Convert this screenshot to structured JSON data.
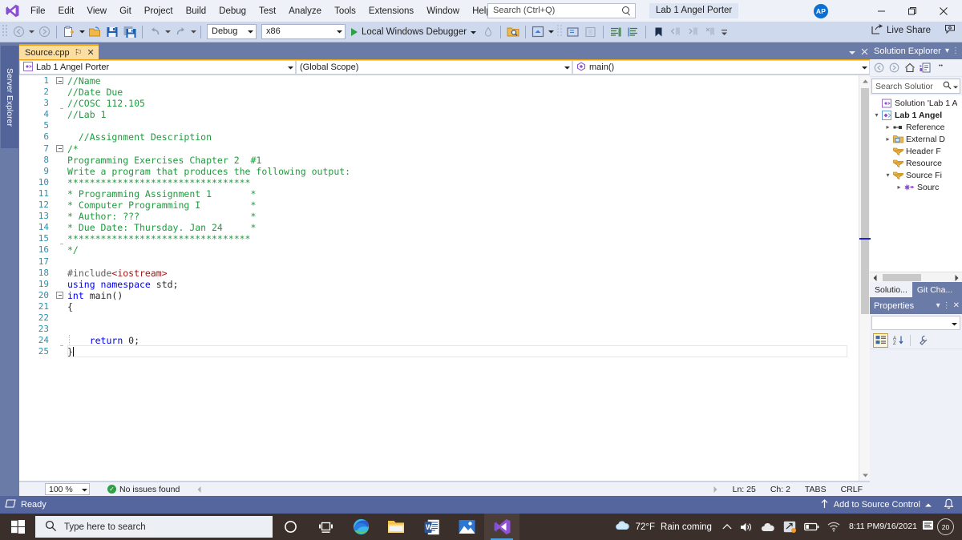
{
  "app": {
    "title": "Lab 1 Angel Porter",
    "logo_icon": "visual-studio-logo-icon",
    "avatar_initials": "AP"
  },
  "menubar": {
    "items": [
      {
        "label": "File"
      },
      {
        "label": "Edit"
      },
      {
        "label": "View"
      },
      {
        "label": "Git"
      },
      {
        "label": "Project"
      },
      {
        "label": "Build"
      },
      {
        "label": "Debug"
      },
      {
        "label": "Test"
      },
      {
        "label": "Analyze"
      },
      {
        "label": "Tools"
      },
      {
        "label": "Extensions"
      },
      {
        "label": "Window"
      },
      {
        "label": "Help"
      }
    ]
  },
  "title_search": {
    "placeholder": "Search (Ctrl+Q)",
    "icon": "search-icon"
  },
  "window_controls": {
    "minimize": "—",
    "maximize": "❐",
    "close": "✕"
  },
  "toolbar": {
    "config_value": "Debug",
    "platform_value": "x86",
    "run_label": "Local Windows Debugger",
    "live_share_label": "Live Share"
  },
  "document_tab": {
    "label": "Source.cpp",
    "pin_glyph": "⚐",
    "close_glyph": "✕"
  },
  "navbar": {
    "project": "Lab 1 Angel Porter",
    "scope": "(Global Scope)",
    "member": "main()"
  },
  "editor": {
    "lines": [
      {
        "n": 1,
        "tokens": [
          {
            "t": "//Name",
            "c": "c-comment"
          }
        ],
        "fold": "open",
        "indent": 0
      },
      {
        "n": 2,
        "tokens": [
          {
            "t": "//Date Due",
            "c": "c-comment"
          }
        ],
        "bar": true
      },
      {
        "n": 3,
        "tokens": [
          {
            "t": "//COSC 112.105",
            "c": "c-comment"
          }
        ],
        "bar": true
      },
      {
        "n": 4,
        "tokens": [
          {
            "t": "//Lab 1",
            "c": "c-comment"
          }
        ],
        "bar": "end"
      },
      {
        "n": 5,
        "tokens": []
      },
      {
        "n": 6,
        "tokens": [
          {
            "t": "  //Assignment Description",
            "c": "c-comment"
          }
        ]
      },
      {
        "n": 7,
        "tokens": [
          {
            "t": "/*",
            "c": "c-comment"
          }
        ],
        "fold": "open"
      },
      {
        "n": 8,
        "tokens": [
          {
            "t": "Programming Exercises Chapter 2  #1",
            "c": "c-comment"
          }
        ],
        "bar": true
      },
      {
        "n": 9,
        "tokens": [
          {
            "t": "Write a program that produces the following output:",
            "c": "c-comment"
          }
        ],
        "bar": true
      },
      {
        "n": 10,
        "tokens": [
          {
            "t": "*********************************",
            "c": "c-comment"
          }
        ],
        "bar": true
      },
      {
        "n": 11,
        "tokens": [
          {
            "t": "* Programming Assignment 1       *",
            "c": "c-comment"
          }
        ],
        "bar": true
      },
      {
        "n": 12,
        "tokens": [
          {
            "t": "* Computer Programming I         *",
            "c": "c-comment"
          }
        ],
        "bar": true
      },
      {
        "n": 13,
        "tokens": [
          {
            "t": "* Author: ???                    *",
            "c": "c-comment"
          }
        ],
        "bar": true
      },
      {
        "n": 14,
        "tokens": [
          {
            "t": "* Due Date: Thursday. Jan 24     *",
            "c": "c-comment"
          }
        ],
        "bar": true
      },
      {
        "n": 15,
        "tokens": [
          {
            "t": "*********************************",
            "c": "c-comment"
          }
        ],
        "bar": true
      },
      {
        "n": 16,
        "tokens": [
          {
            "t": "*/",
            "c": "c-comment"
          }
        ],
        "bar": "end"
      },
      {
        "n": 17,
        "tokens": []
      },
      {
        "n": 18,
        "tokens": [
          {
            "t": "#include",
            "c": "c-pp"
          },
          {
            "t": "<iostream>",
            "c": "c-str"
          }
        ]
      },
      {
        "n": 19,
        "tokens": [
          {
            "t": "using namespace ",
            "c": "c-kw"
          },
          {
            "t": "std;",
            "c": "c-plain"
          }
        ]
      },
      {
        "n": 20,
        "tokens": [
          {
            "t": "int ",
            "c": "c-kw"
          },
          {
            "t": "main()",
            "c": "c-plain"
          }
        ],
        "fold": "open"
      },
      {
        "n": 21,
        "tokens": [
          {
            "t": "{",
            "c": "c-plain"
          }
        ],
        "bar": true
      },
      {
        "n": 22,
        "tokens": [],
        "bar": true,
        "dotted": true
      },
      {
        "n": 23,
        "tokens": [],
        "bar": true,
        "dotted": true
      },
      {
        "n": 24,
        "tokens": [
          {
            "t": "    ",
            "c": "c-plain"
          },
          {
            "t": "return ",
            "c": "c-kw"
          },
          {
            "t": "0;",
            "c": "c-plain"
          }
        ],
        "bar": true,
        "dotted": true
      },
      {
        "n": 25,
        "tokens": [
          {
            "t": "}",
            "c": "c-plain"
          }
        ],
        "bar": "end",
        "caret": true
      }
    ]
  },
  "editor_status": {
    "zoom": "100 %",
    "issues": "No issues found",
    "issues_icon": "check-circle-icon",
    "line": "Ln: 25",
    "char": "Ch: 2",
    "tabs": "TABS",
    "eol": "CRLF"
  },
  "left_dock": {
    "server_explorer": "Server Explorer"
  },
  "solution_explorer": {
    "title": "Solution Explorer",
    "search_placeholder": "Search Solutior",
    "tabs": [
      {
        "label": "Solutio...",
        "active": true
      },
      {
        "label": "Git Cha...",
        "active": false
      }
    ],
    "tree": [
      {
        "depth": 0,
        "arrow": "",
        "icon": "solution-icon",
        "label": "Solution 'Lab 1 A",
        "bold": false
      },
      {
        "depth": 0,
        "arrow": "▾",
        "icon": "project-icon",
        "label": "Lab 1 Angel",
        "bold": true
      },
      {
        "depth": 1,
        "arrow": "▸",
        "icon": "references-icon",
        "label": "Reference",
        "bold": false
      },
      {
        "depth": 1,
        "arrow": "▸",
        "icon": "external-dep-icon",
        "label": "External D",
        "bold": false
      },
      {
        "depth": 1,
        "arrow": "",
        "icon": "folder-filter-icon",
        "label": "Header F",
        "bold": false
      },
      {
        "depth": 1,
        "arrow": "",
        "icon": "folder-filter-icon",
        "label": "Resource",
        "bold": false
      },
      {
        "depth": 1,
        "arrow": "▾",
        "icon": "folder-filter-icon",
        "label": "Source Fi",
        "bold": false
      },
      {
        "depth": 2,
        "arrow": "▸",
        "icon": "cpp-file-icon",
        "label": "Sourc",
        "bold": false
      }
    ]
  },
  "properties_panel": {
    "title": "Properties"
  },
  "vs_status": {
    "ready": "Ready",
    "add_to_source_control": "Add to Source Control",
    "notification_icon": "bell-icon"
  },
  "taskbar": {
    "start_icon": "windows-start-icon",
    "search_placeholder": "Type here to search",
    "search_icon": "search-icon",
    "items": [
      {
        "name": "cortana-icon",
        "active": false,
        "running": false
      },
      {
        "name": "task-view-icon",
        "active": false,
        "running": false
      },
      {
        "name": "microsoft-edge-icon",
        "active": false,
        "running": true
      },
      {
        "name": "file-explorer-icon",
        "active": false,
        "running": true
      },
      {
        "name": "microsoft-word-icon",
        "active": false,
        "running": true
      },
      {
        "name": "photos-icon",
        "active": false,
        "running": true
      },
      {
        "name": "visual-studio-icon",
        "active": true,
        "running": true
      }
    ],
    "weather_temp": "72°F",
    "weather_desc": "Rain coming",
    "time": "8:11 PM",
    "date": "9/16/2021",
    "notification_count": "20"
  },
  "colors": {
    "accent_blue": "#55659d",
    "tab_orange": "#f0a30a",
    "comment_green": "#1f9b3e",
    "keyword_blue": "#0000ff",
    "string_red": "#a31515",
    "run_green": "#2e9e47"
  }
}
